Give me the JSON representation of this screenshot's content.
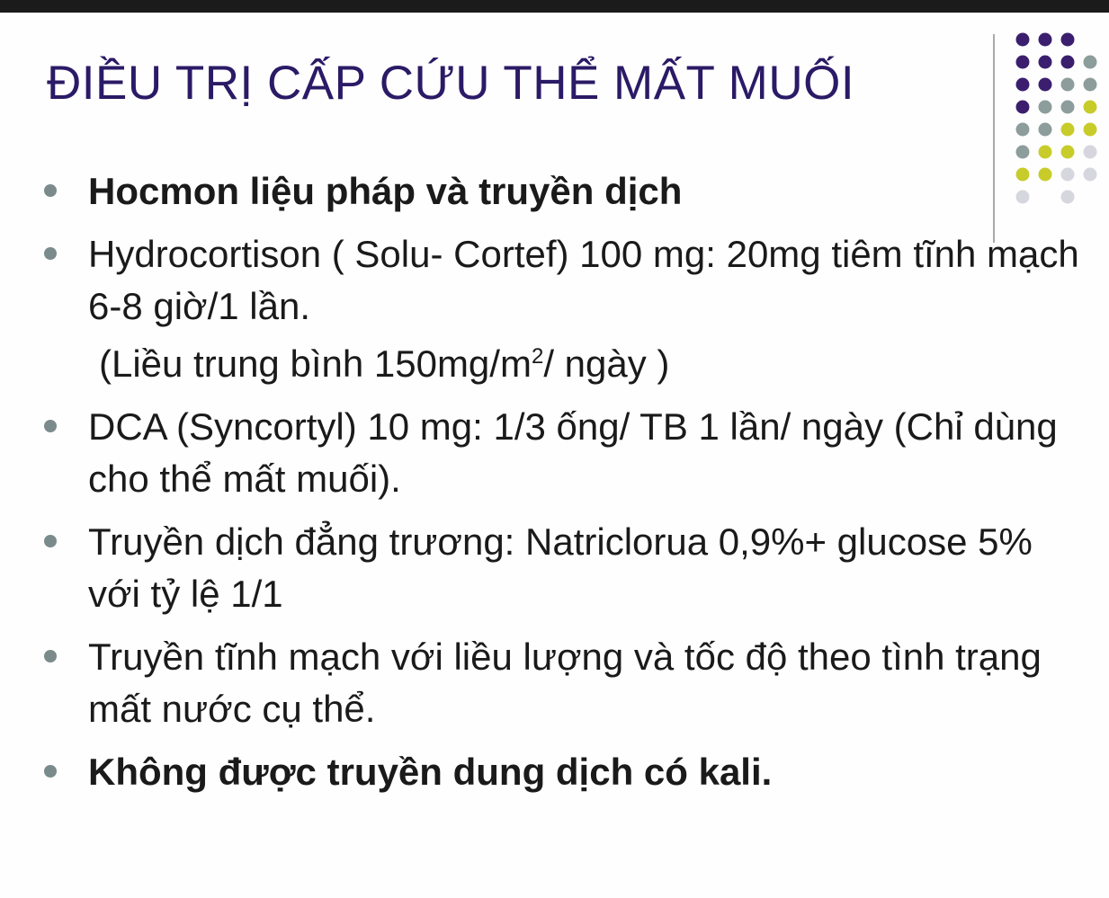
{
  "slide": {
    "title": "ĐIỀU TRỊ CẤP CỨU  THỂ MẤT MUỐI",
    "items": [
      {
        "text": "Hocmon liệu pháp và truyền dịch"
      },
      {
        "text": "Hydrocortison ( Solu- Cortef) 100 mg: 20mg tiêm tĩnh mạch 6-8 giờ/1 lần."
      },
      {
        "text": "DCA (Syncortyl) 10 mg: 1/3 ống/ TB 1 lần/ ngày (Chỉ dùng cho thể mất muối)."
      },
      {
        "text": "Truyền dịch đẳng trương:  Natriclorua 0,9%+ glucose 5% với tỷ lệ 1/1"
      },
      {
        "text": "Truyền tĩnh mạch với liều lượng và tốc độ theo tình trạng mất nước cụ thể."
      },
      {
        "text": "Không được truyền dung dịch có kali."
      }
    ],
    "dose_note": {
      "prefix": "(Liều trung bình 150mg/m",
      "superscript": "2",
      "suffix": "/ ngày )"
    }
  },
  "decoration": {
    "dot_colors": {
      "purple": "#3b1f6e",
      "gray": "#8c9d9b",
      "lime": "#c8cc2a",
      "light": "#d6d6df"
    }
  }
}
